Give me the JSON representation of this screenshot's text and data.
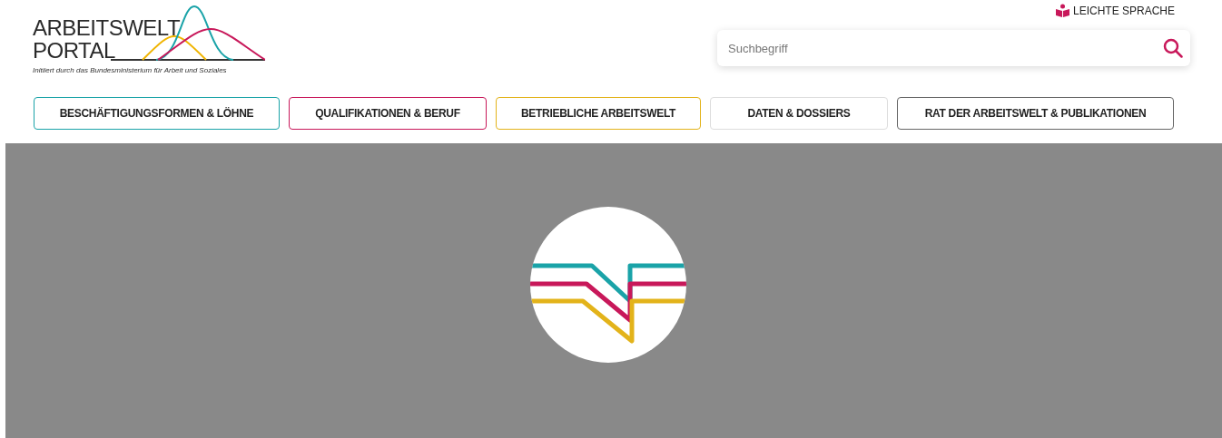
{
  "logo": {
    "title_line_1": "ARBEITSWELT",
    "title_line_2": "PORTAL",
    "subtitle": "Initiiert durch das Bundesministerium für Arbeit und Soziales"
  },
  "easy_language_link": "LEICHTE SPRACHE",
  "search": {
    "placeholder": "Suchbegriff"
  },
  "nav": [
    {
      "label": "BESCHÄFTIGUNGSFORMEN & LÖHNE",
      "color": "#1aa3a8"
    },
    {
      "label": "QUALIFIKATIONEN & BERUF",
      "color": "#c8185a"
    },
    {
      "label": "BETRIEBLICHE ARBEITSWELT",
      "color": "#e3b31a"
    },
    {
      "label": "DATEN & DOSSIERS",
      "color": "#dddddd"
    },
    {
      "label": "RAT DER ARBEITSWELT & PUBLIKATIONEN",
      "color": "#666666"
    }
  ]
}
